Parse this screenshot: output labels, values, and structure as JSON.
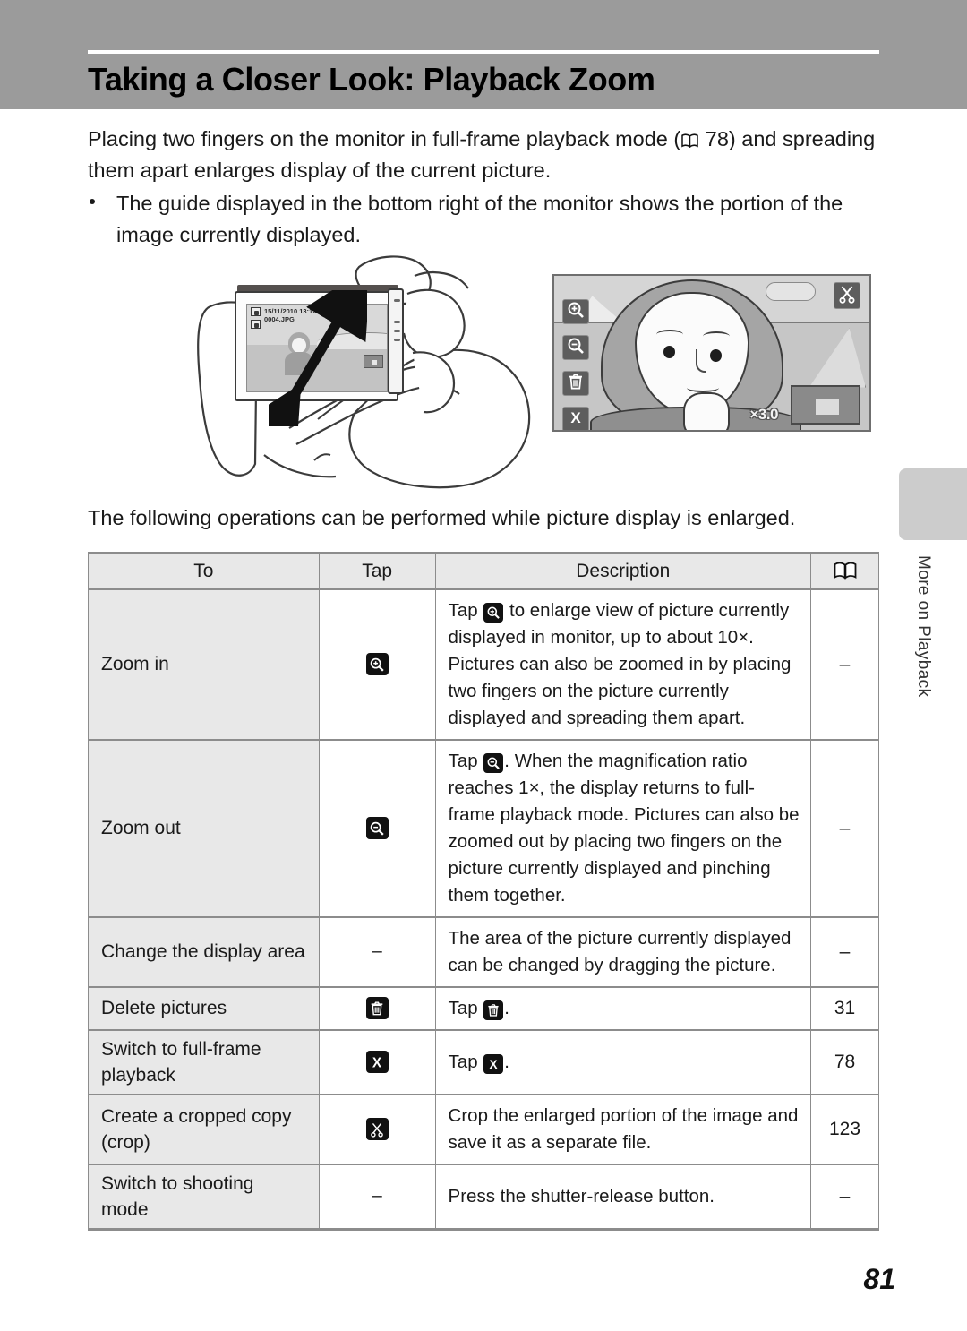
{
  "header": {
    "title": "Taking a Closer Look: Playback Zoom",
    "band_color": "#9b9b9b"
  },
  "intro": {
    "paragraph_part1": "Placing two fingers on the monitor in full-frame playback mode (",
    "page_ref": "78",
    "paragraph_part2": ") and spreading them apart enlarges display of the current picture.",
    "bullet": "The guide displayed in the bottom right of the monitor shows the portion of the image currently displayed."
  },
  "illustration": {
    "camera_osd_line1": "15/11/2010  13:12",
    "camera_osd_line2": "0004.JPG",
    "transition_arrow": "arrow-right-icon",
    "monitor": {
      "buttons": [
        "zoom-in-icon",
        "zoom-out-icon",
        "delete-icon",
        "close-icon"
      ],
      "crop_button": "crop-scissors-icon",
      "magnification": "×3.0",
      "guide_label": "navigation-guide"
    }
  },
  "mid_paragraph": "The following operations can be performed while picture display is enlarged.",
  "table": {
    "headers": {
      "to": "To",
      "tap": "Tap",
      "description": "Description",
      "reference": "book-icon"
    },
    "rows": [
      {
        "to": "Zoom in",
        "tap_icon": "zoom-in-icon",
        "desc_prefix": "Tap ",
        "desc_icon": "zoom-in-icon",
        "desc_suffix": " to enlarge view of picture currently displayed in monitor, up to about 10×. Pictures can also be zoomed in by placing two fingers on the picture currently displayed and spreading them apart.",
        "ref": "–"
      },
      {
        "to": "Zoom out",
        "tap_icon": "zoom-out-icon",
        "desc_prefix": "Tap ",
        "desc_icon": "zoom-out-icon",
        "desc_suffix": ". When the magnification ratio reaches 1×, the display returns to full-frame playback mode. Pictures can also be zoomed out by placing two fingers on the picture currently displayed and pinching them together.",
        "ref": "–"
      },
      {
        "to": "Change the display area",
        "tap_icon": "none",
        "tap_text": "–",
        "desc_prefix": "The area of the picture currently displayed can be changed by dragging the picture.",
        "desc_icon": "none",
        "desc_suffix": "",
        "ref": "–"
      },
      {
        "to": "Delete pictures",
        "tap_icon": "delete-icon",
        "desc_prefix": "Tap ",
        "desc_icon": "delete-icon",
        "desc_suffix": ".",
        "ref": "31"
      },
      {
        "to": "Switch to full-frame playback",
        "tap_icon": "close-icon",
        "desc_prefix": "Tap ",
        "desc_icon": "close-icon",
        "desc_suffix": ".",
        "ref": "78"
      },
      {
        "to": "Create a cropped copy (crop)",
        "tap_icon": "crop-scissors-icon",
        "desc_prefix": "Crop the enlarged portion of the image and save it as a separate file.",
        "desc_icon": "none",
        "desc_suffix": "",
        "ref": "123"
      },
      {
        "to": "Switch to shooting mode",
        "tap_icon": "none",
        "tap_text": "–",
        "desc_prefix": "Press the shutter-release button.",
        "desc_icon": "none",
        "desc_suffix": "",
        "ref": "–"
      }
    ]
  },
  "side_tab": {
    "label": "More on Playback"
  },
  "page_number": "81"
}
